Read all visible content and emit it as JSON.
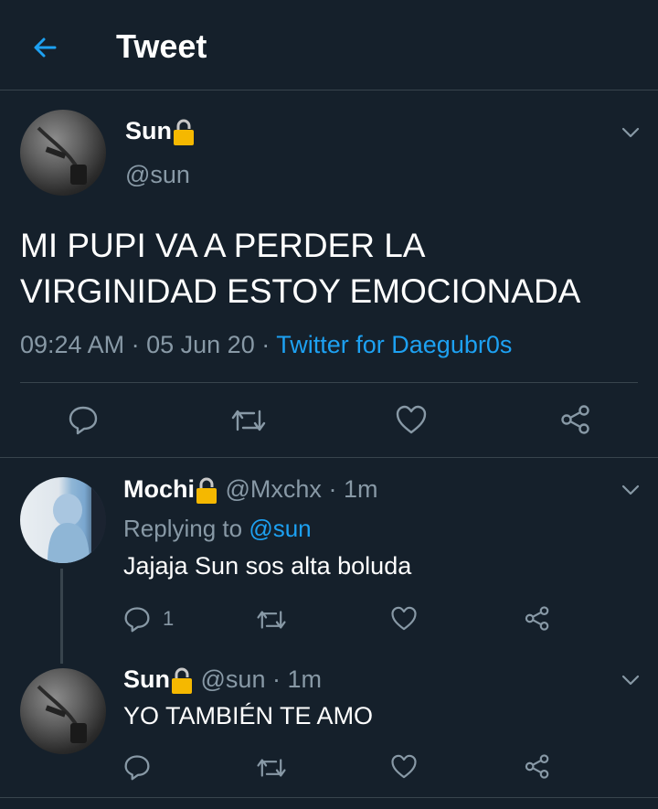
{
  "header": {
    "title": "Tweet",
    "back_icon": "arrow-left-icon"
  },
  "main_tweet": {
    "name": "Sun",
    "handle": "@sun",
    "text_line1": "MI PUPI VA A PERDER LA",
    "text_line2": "VIRGINIDAD ESTOY EMOCIONADA",
    "time": "09:24 AM",
    "sep1": "·",
    "date": "05 Jun 20",
    "sep2": "·",
    "source": "Twitter for Daegubr0s"
  },
  "reply1": {
    "name": "Mochi",
    "handle": "@Mxchx",
    "sep": "·",
    "age": "1m",
    "replying_prefix": "Replying to",
    "replying_to": "@sun",
    "text": "Jajaja Sun sos alta boluda",
    "reply_count": "1"
  },
  "reply2": {
    "name": "Sun",
    "handle": "@sun",
    "sep": "·",
    "age": "1m",
    "text": "YO TAMBIÉN TE AMO"
  },
  "colors": {
    "background": "#15202b",
    "accent": "#1da1f2",
    "muted": "#8899a6",
    "lock": "#f5b800",
    "divider": "#38444d"
  }
}
